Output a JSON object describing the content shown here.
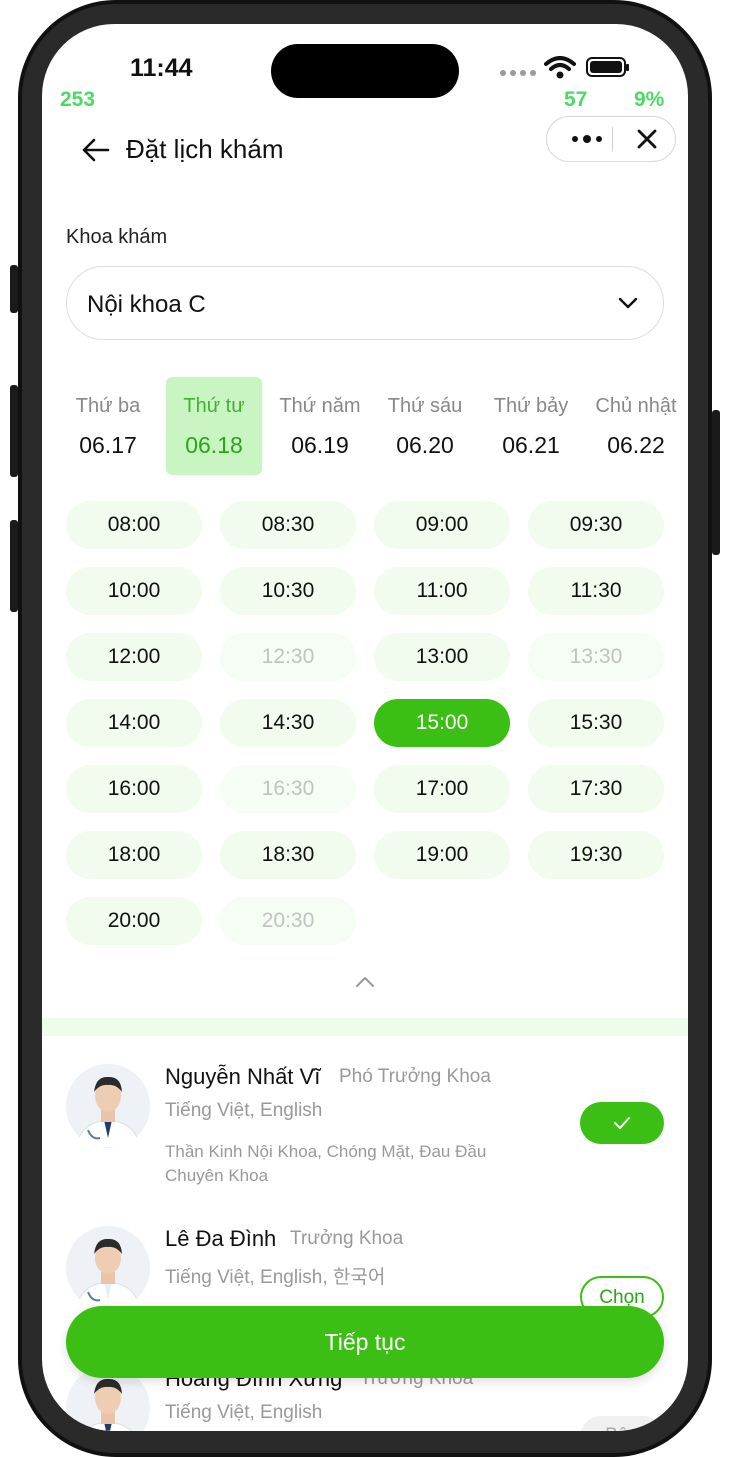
{
  "status_bar": {
    "time": "11:44",
    "debug_left": "253",
    "debug_mid": "57",
    "debug_right": "9%"
  },
  "header": {
    "title": "Đặt lịch khám",
    "back_icon": "arrow-left-icon",
    "more_icon": "more-dots-icon",
    "close_icon": "close-icon"
  },
  "department": {
    "label": "Khoa khám",
    "selected": "Nội khoa C"
  },
  "days": [
    {
      "name": "Thứ ba",
      "date": "06.17"
    },
    {
      "name": "Thứ tư",
      "date": "06.18",
      "selected": true
    },
    {
      "name": "Thứ năm",
      "date": "06.19"
    },
    {
      "name": "Thứ sáu",
      "date": "06.20"
    },
    {
      "name": "Thứ bảy",
      "date": "06.21"
    },
    {
      "name": "Chủ nhật",
      "date": "06.22"
    }
  ],
  "slots": [
    {
      "time": "08:00",
      "state": "available"
    },
    {
      "time": "08:30",
      "state": "available"
    },
    {
      "time": "09:00",
      "state": "available"
    },
    {
      "time": "09:30",
      "state": "available"
    },
    {
      "time": "10:00",
      "state": "available"
    },
    {
      "time": "10:30",
      "state": "available"
    },
    {
      "time": "11:00",
      "state": "available"
    },
    {
      "time": "11:30",
      "state": "available"
    },
    {
      "time": "12:00",
      "state": "available"
    },
    {
      "time": "12:30",
      "state": "disabled"
    },
    {
      "time": "13:00",
      "state": "available"
    },
    {
      "time": "13:30",
      "state": "disabled"
    },
    {
      "time": "14:00",
      "state": "available"
    },
    {
      "time": "14:30",
      "state": "available"
    },
    {
      "time": "15:00",
      "state": "selected"
    },
    {
      "time": "15:30",
      "state": "available"
    },
    {
      "time": "16:00",
      "state": "available"
    },
    {
      "time": "16:30",
      "state": "disabled"
    },
    {
      "time": "17:00",
      "state": "available"
    },
    {
      "time": "17:30",
      "state": "available"
    },
    {
      "time": "18:00",
      "state": "available"
    },
    {
      "time": "18:30",
      "state": "available"
    },
    {
      "time": "19:00",
      "state": "available"
    },
    {
      "time": "19:30",
      "state": "available"
    },
    {
      "time": "20:00",
      "state": "available"
    },
    {
      "time": "20:30",
      "state": "disabled"
    }
  ],
  "doctors": [
    {
      "name": "Nguyễn Nhất Vĩ",
      "title": "Phó Trưởng Khoa",
      "languages": "Tiếng Việt, English",
      "specialty": "Thần Kinh Nội Khoa, Chóng Mặt, Đau Đầu Chuyên Khoa",
      "action": "checked",
      "action_label": ""
    },
    {
      "name": "Lê Đa Đình",
      "title": "Trưởng Khoa",
      "languages": "Tiếng Việt, English, 한국어",
      "specialty": "",
      "action": "choose",
      "action_label": "Chọn"
    },
    {
      "name": "Hoàng Đình Xừng",
      "title": "Trưởng Khoa",
      "languages": "Tiếng Việt, English",
      "specialty": "",
      "action": "busy",
      "action_label": "Bận"
    }
  ],
  "cta": {
    "label": "Tiếp tục"
  },
  "colors": {
    "accent": "#3cbf14",
    "accent_light": "#f1fcef",
    "selected_day_bg": "#c9f5c2"
  }
}
